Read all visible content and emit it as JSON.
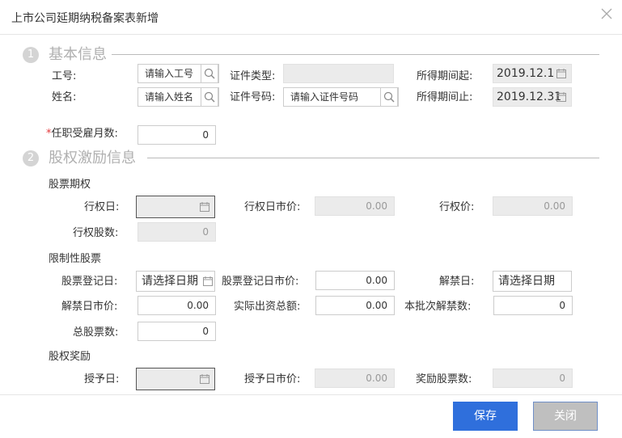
{
  "dialog": {
    "title": "上市公司延期纳税备案表新增"
  },
  "section1": {
    "num": "1",
    "title": "基本信息"
  },
  "section2": {
    "num": "2",
    "title": "股权激励信息"
  },
  "basic": {
    "emp_no_label": "工号:",
    "emp_no_placeholder": "请输入工号",
    "name_label": "姓名:",
    "name_placeholder": "请输入姓名",
    "id_type_label": "证件类型:",
    "id_type_value": "",
    "id_no_label": "证件号码:",
    "id_no_placeholder": "请输入证件号码",
    "period_start_label": "所得期间起:",
    "period_start_value": "2019.12.1",
    "period_end_label": "所得期间止:",
    "period_end_value": "2019.12.31",
    "months_required": "*",
    "months_label": "任职受雇月数:",
    "months_value": "0"
  },
  "stock_option": {
    "group_label": "股票期权",
    "exercise_date_label": "行权日:",
    "exercise_date_value": "",
    "exercise_market_price_label": "行权日市价:",
    "exercise_market_price_value": "0.00",
    "exercise_price_label": "行权价:",
    "exercise_price_value": "0.00",
    "exercise_shares_label": "行权股数:",
    "exercise_shares_value": "0"
  },
  "restricted_stock": {
    "group_label": "限制性股票",
    "register_date_label": "股票登记日:",
    "register_date_placeholder": "请选择日期",
    "register_market_price_label": "股票登记日市价:",
    "register_market_price_value": "0.00",
    "unlock_date_label": "解禁日:",
    "unlock_date_placeholder": "请选择日期",
    "unlock_market_price_label": "解禁日市价:",
    "unlock_market_price_value": "0.00",
    "actual_paid_label": "实际出资总额:",
    "actual_paid_value": "0.00",
    "unlock_shares_label": "本批次解禁数:",
    "unlock_shares_value": "0",
    "total_shares_label": "总股票数:",
    "total_shares_value": "0"
  },
  "equity_reward": {
    "group_label": "股权奖励",
    "grant_date_label": "授予日:",
    "grant_date_value": "",
    "grant_market_price_label": "授予日市价:",
    "grant_market_price_value": "0.00",
    "reward_shares_label": "奖励股票数:",
    "reward_shares_value": "0"
  },
  "footer": {
    "save_label": "保存",
    "close_label": "关闭"
  },
  "colors": {
    "primary": "#2f6fdc",
    "disabled_bg": "#ebebeb",
    "required": "#e4393c"
  },
  "icons": {
    "close": "close-icon",
    "search": "search-icon",
    "calendar": "calendar-icon"
  }
}
